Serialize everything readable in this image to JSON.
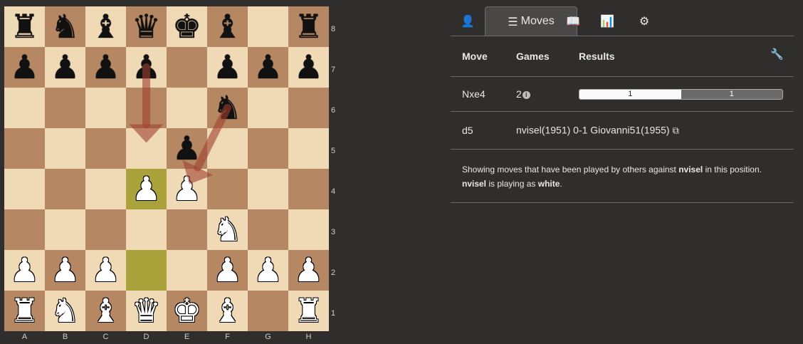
{
  "board": {
    "ranks": [
      "8",
      "7",
      "6",
      "5",
      "4",
      "3",
      "2",
      "1"
    ],
    "files": [
      "A",
      "B",
      "C",
      "D",
      "E",
      "F",
      "G",
      "H"
    ],
    "pieces": [
      [
        "r",
        "n",
        "b",
        "q",
        "k",
        "b",
        "",
        "r"
      ],
      [
        "p",
        "p",
        "p",
        "p",
        "",
        "p",
        "p",
        "p"
      ],
      [
        "",
        "",
        "",
        "",
        "",
        "n",
        "",
        ""
      ],
      [
        "",
        "",
        "",
        "",
        "p",
        "",
        "",
        ""
      ],
      [
        "",
        "",
        "",
        "P",
        "P",
        "",
        "",
        ""
      ],
      [
        "",
        "",
        "",
        "",
        "",
        "N",
        "",
        ""
      ],
      [
        "P",
        "P",
        "P",
        "",
        "",
        "P",
        "P",
        "P"
      ],
      [
        "R",
        "N",
        "B",
        "Q",
        "K",
        "B",
        "",
        "R"
      ]
    ],
    "highlighted_squares": [
      "d4",
      "d2"
    ],
    "arrows": [
      {
        "from": "d7",
        "to": "d5"
      },
      {
        "from": "f6",
        "to": "e4"
      }
    ],
    "colors": {
      "light": "#f0d9b5",
      "dark": "#b58863",
      "highlight": "#aaa23a",
      "arrow": "#a04030"
    }
  },
  "tabs": [
    {
      "icon": "user-icon",
      "glyph": "👤",
      "label": ""
    },
    {
      "icon": "list-icon",
      "glyph": "☰",
      "label": "Moves",
      "active": true
    },
    {
      "icon": "book-icon",
      "glyph": "📖",
      "label": ""
    },
    {
      "icon": "bar-chart-icon",
      "glyph": "📊",
      "label": ""
    },
    {
      "icon": "gear-icon",
      "glyph": "⚙",
      "label": ""
    }
  ],
  "moves_table": {
    "headers": {
      "move": "Move",
      "games": "Games",
      "results": "Results"
    },
    "wrench_icon": "wrench-icon",
    "rows": [
      {
        "move": "Nxe4",
        "games": "2",
        "info_glyph": "i",
        "white_pct": 0.5,
        "white_label": "1",
        "black_label": "1"
      },
      {
        "move": "d5",
        "game_text": "nvisel(1951) 0-1 Giovanni51(1955)",
        "link_icon": "external-link-icon"
      }
    ]
  },
  "note": {
    "line1_a": "Showing moves that have been played by others against ",
    "line1_b": "nvisel",
    "line1_c": " in this position.",
    "line2_a": "nvisel",
    "line2_b": " is playing as ",
    "line2_c": "white",
    "line2_d": "."
  }
}
